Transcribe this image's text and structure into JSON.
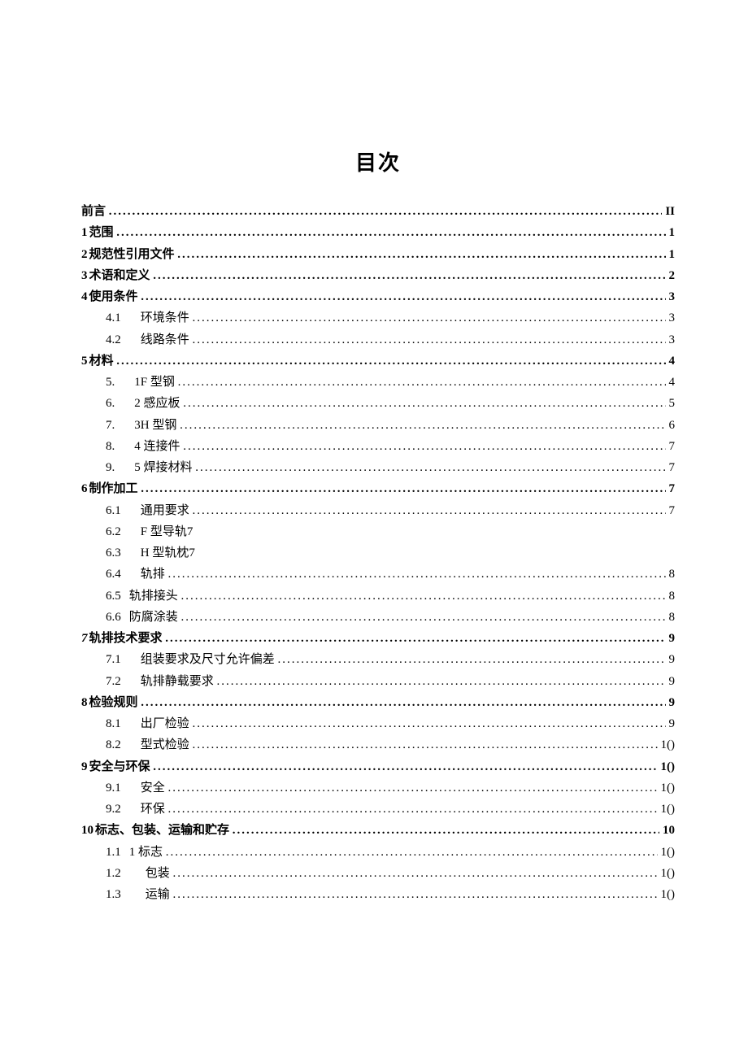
{
  "title": "目次",
  "entries": [
    {
      "num": "",
      "label": "前言",
      "page": "II",
      "indent": 0,
      "bold": true,
      "dots": true
    },
    {
      "num": "1",
      "label": "范围",
      "page": "1",
      "indent": 0,
      "bold": true,
      "dots": true
    },
    {
      "num": "2",
      "label": "规范性引用文件",
      "page": "1",
      "indent": 0,
      "bold": true,
      "dots": true
    },
    {
      "num": "3",
      "label": "术语和定义",
      "page": "2",
      "indent": 0,
      "bold": true,
      "dots": true
    },
    {
      "num": "4",
      "label": "使用条件",
      "page": "3",
      "indent": 0,
      "bold": true,
      "dots": true
    },
    {
      "num": "4.1",
      "label": "环境条件",
      "page": "3",
      "indent": 1,
      "bold": false,
      "dots": true,
      "gap": "wide"
    },
    {
      "num": "4.2",
      "label": "线路条件",
      "page": "3",
      "indent": 1,
      "bold": false,
      "dots": true,
      "gap": "wide"
    },
    {
      "num": "5",
      "label": "材料",
      "page": "4",
      "indent": 0,
      "bold": true,
      "dots": true
    },
    {
      "num": "5.",
      "label": "1F 型钢",
      "page": "4",
      "indent": 1,
      "bold": false,
      "dots": true,
      "gap": "wide"
    },
    {
      "num": "6.",
      "label": "2 感应板",
      "page": "5",
      "indent": 1,
      "bold": false,
      "dots": true,
      "gap": "wide"
    },
    {
      "num": "7.",
      "label": "3H 型钢",
      "page": "6",
      "indent": 1,
      "bold": false,
      "dots": true,
      "gap": "wide"
    },
    {
      "num": "8.",
      "label": "4 连接件",
      "page": "7",
      "indent": 1,
      "bold": false,
      "dots": true,
      "gap": "wide"
    },
    {
      "num": "9.",
      "label": "5 焊接材料",
      "page": "7",
      "indent": 1,
      "bold": false,
      "dots": true,
      "gap": "wide"
    },
    {
      "num": "6",
      "label": "制作加工",
      "page": "7",
      "indent": 0,
      "bold": true,
      "dots": true
    },
    {
      "num": "6.1",
      "label": "通用要求",
      "page": "7",
      "indent": 1,
      "bold": false,
      "dots": true,
      "gap": "wide"
    },
    {
      "num": "6.2",
      "label": "F 型导轨7",
      "page": "",
      "indent": 1,
      "bold": false,
      "dots": false,
      "gap": "wide"
    },
    {
      "num": "6.3",
      "label": "H 型轨枕7",
      "page": "",
      "indent": 1,
      "bold": false,
      "dots": false,
      "gap": "wide"
    },
    {
      "num": "6.4",
      "label": "轨排",
      "page": "8",
      "indent": 1,
      "bold": false,
      "dots": true,
      "gap": "wide"
    },
    {
      "num": "6.5",
      "label": "轨排接头",
      "page": "8",
      "indent": 1,
      "bold": false,
      "dots": true,
      "gap": "tight"
    },
    {
      "num": "6.6",
      "label": "防腐涂装",
      "page": "8",
      "indent": 1,
      "bold": false,
      "dots": true,
      "gap": "tight"
    },
    {
      "num": "7",
      "label": "轨排技术要求",
      "page": "9",
      "indent": 0,
      "bold": true,
      "dots": true,
      "italic_num": true
    },
    {
      "num": "7.1",
      "label": "组装要求及尺寸允许偏差",
      "page": "9",
      "indent": 1,
      "bold": false,
      "dots": true,
      "gap": "wide"
    },
    {
      "num": "7.2",
      "label": "轨排静载要求",
      "page": "9",
      "indent": 1,
      "bold": false,
      "dots": true,
      "gap": "wide"
    },
    {
      "num": "8",
      "label": "检验规则",
      "page": "9",
      "indent": 0,
      "bold": true,
      "dots": true
    },
    {
      "num": "8.1",
      "label": "出厂检验",
      "page": "9",
      "indent": 1,
      "bold": false,
      "dots": true,
      "gap": "wide"
    },
    {
      "num": "8.2",
      "label": "型式检验",
      "page": "1()",
      "indent": 1,
      "bold": false,
      "dots": true,
      "gap": "wide"
    },
    {
      "num": "9",
      "label": "安全与环保",
      "page": "1()",
      "indent": 0,
      "bold": true,
      "dots": true
    },
    {
      "num": "9.1",
      "label": "安全",
      "page": "1()",
      "indent": 1,
      "bold": false,
      "dots": true,
      "gap": "wide"
    },
    {
      "num": "9.2",
      "label": "环保",
      "page": "1()",
      "indent": 1,
      "bold": false,
      "dots": true,
      "gap": "wide"
    },
    {
      "num": "10",
      "label": "标志、包装、运输和贮存",
      "page": "10",
      "indent": 0,
      "bold": true,
      "dots": true
    },
    {
      "num": "1.1",
      "label": "1 标志",
      "page": "1()",
      "indent": 1,
      "bold": false,
      "dots": true,
      "gap": "tight"
    },
    {
      "num": "1.2",
      "label": "包装",
      "page": "1()",
      "indent": 1,
      "bold": false,
      "dots": true,
      "gap": "wide2"
    },
    {
      "num": "1.3",
      "label": "运输",
      "page": "1()",
      "indent": 1,
      "bold": false,
      "dots": true,
      "gap": "wide2"
    }
  ]
}
